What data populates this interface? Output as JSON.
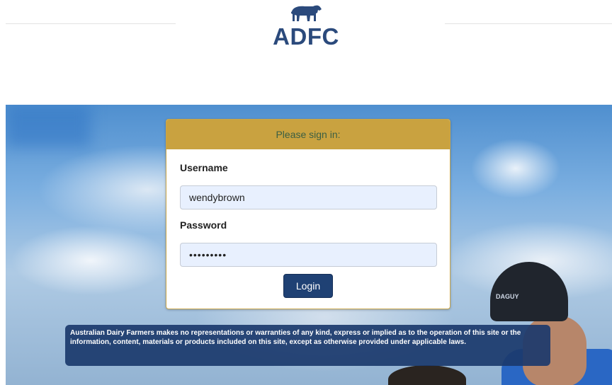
{
  "brand": {
    "logo_text": "ADFC",
    "logo_icon": "cow-icon",
    "primary_color": "#2b4a7c"
  },
  "login": {
    "heading": "Please sign in:",
    "username_label": "Username",
    "username_value": "wendybrown",
    "password_label": "Password",
    "password_value": "•••••••••",
    "login_button": "Login",
    "header_color": "#c9a240",
    "button_color": "#1f4174"
  },
  "hero": {
    "cap_text": "DAGUY"
  },
  "disclaimer": {
    "text": "Australian Dairy Farmers makes no representations or warranties of any kind, express or implied as to the operation of this site or the information, content, materials or products included on this site, except as otherwise provided under applicable laws."
  }
}
